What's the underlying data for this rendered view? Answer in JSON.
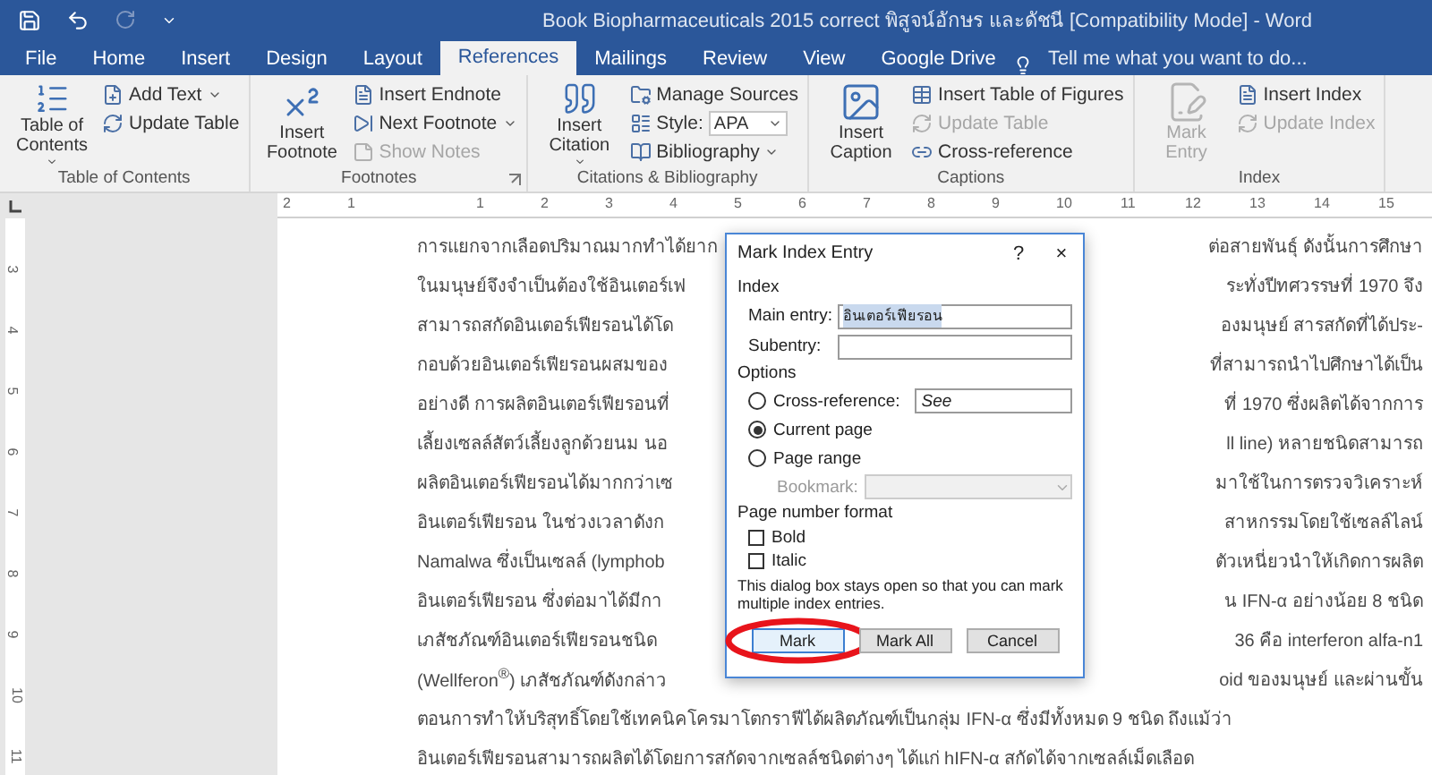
{
  "title_bar": {
    "title": "Book Biopharmaceuticals 2015 correct พิสูจน์อักษร และดัชนี [Compatibility Mode] - Word"
  },
  "tabs": [
    {
      "label": "File",
      "selected": false
    },
    {
      "label": "Home",
      "selected": false
    },
    {
      "label": "Insert",
      "selected": false
    },
    {
      "label": "Design",
      "selected": false
    },
    {
      "label": "Layout",
      "selected": false
    },
    {
      "label": "References",
      "selected": true
    },
    {
      "label": "Mailings",
      "selected": false
    },
    {
      "label": "Review",
      "selected": false
    },
    {
      "label": "View",
      "selected": false
    },
    {
      "label": "Google Drive",
      "selected": false
    }
  ],
  "tell_me": {
    "placeholder": "Tell me what you want to do..."
  },
  "ribbon_groups": [
    {
      "label": "Table of Contents",
      "launcher": false,
      "large": {
        "label": "Table of Contents",
        "dropdown": true,
        "disabled": false
      },
      "small": [
        {
          "kind": "button",
          "label": "Add Text",
          "dropdown": true,
          "disabled": false
        },
        {
          "kind": "button",
          "label": "Update Table",
          "dropdown": false,
          "disabled": false
        }
      ]
    },
    {
      "label": "Footnotes",
      "launcher": true,
      "large": {
        "label": "Insert Footnote",
        "dropdown": false,
        "disabled": false
      },
      "small": [
        {
          "kind": "button",
          "label": "Insert Endnote",
          "dropdown": false,
          "disabled": false
        },
        {
          "kind": "button",
          "label": "Next Footnote",
          "dropdown": true,
          "disabled": false
        },
        {
          "kind": "button",
          "label": "Show Notes",
          "dropdown": false,
          "disabled": true
        }
      ]
    },
    {
      "label": "Citations & Bibliography",
      "launcher": false,
      "large": {
        "label": "Insert Citation",
        "dropdown": true,
        "disabled": false
      },
      "small": [
        {
          "kind": "button",
          "label": "Manage Sources",
          "dropdown": false,
          "disabled": false
        },
        {
          "kind": "select",
          "label": "Style:",
          "value": "APA",
          "disabled": false
        },
        {
          "kind": "button",
          "label": "Bibliography",
          "dropdown": true,
          "disabled": false
        }
      ]
    },
    {
      "label": "Captions",
      "launcher": false,
      "large": {
        "label": "Insert Caption",
        "dropdown": false,
        "disabled": false
      },
      "small": [
        {
          "kind": "button",
          "label": "Insert Table of Figures",
          "dropdown": false,
          "disabled": false
        },
        {
          "kind": "button",
          "label": "Update Table",
          "dropdown": false,
          "disabled": true
        },
        {
          "kind": "button",
          "label": "Cross-reference",
          "dropdown": false,
          "disabled": false
        }
      ]
    },
    {
      "label": "Index",
      "launcher": false,
      "large": {
        "label": "Mark Entry",
        "dropdown": false,
        "disabled": true
      },
      "small": [
        {
          "kind": "button",
          "label": "Insert Index",
          "dropdown": false,
          "disabled": false
        },
        {
          "kind": "button",
          "label": "Update Index",
          "dropdown": false,
          "disabled": true
        }
      ]
    }
  ],
  "rulers": {
    "horizontal": [
      "2",
      "1",
      "1",
      "2",
      "3",
      "4",
      "5",
      "6",
      "7",
      "8",
      "9",
      "10",
      "11",
      "12",
      "13",
      "14",
      "15"
    ],
    "vertical": [
      "3",
      "4",
      "5",
      "6",
      "7",
      "8",
      "9",
      "10",
      "11"
    ]
  },
  "document": {
    "lines": [
      {
        "left": "การแยกจากเลือดปริมาณมากทำได้ยาก",
        "right": "ต่อสายพันธุ์ ดังนั้นการศึกษา"
      },
      {
        "left": "ในมนุษย์จึงจำเป็นต้องใช้อินเตอร์เฟ",
        "right": "ระทั่งปีทศวรรษที่ 1970 จึง"
      },
      {
        "left": "สามารถสกัดอินเตอร์เฟียรอนได้โด",
        "right": "องมนุษย์ สารสกัดที่ได้ประ-"
      },
      {
        "left": "กอบด้วยอินเตอร์เฟียรอนผสมของ",
        "right": "ที่สามารถนำไปศึกษาได้เป็น"
      },
      {
        "left": "อย่างดี การผลิตอินเตอร์เฟียรอนที่",
        "right": "ที่ 1970 ซึ่งผลิตได้จากการ"
      },
      {
        "left": "เลี้ยงเซลล์สัตว์เลี้ยงลูกด้วยนม นอ",
        "right": "ll line) หลายชนิดสามารถ"
      },
      {
        "left": "ผลิตอินเตอร์เฟียรอนได้มากกว่าเซ",
        "right": "มาใช้ในการตรวจวิเคราะห์"
      },
      {
        "left": "อินเตอร์เฟียรอน ในช่วงเวลาดังก",
        "right": "สาหกรรมโดยใช้เซลล์ไลน์"
      },
      {
        "left": "Namalwa ซึ่งเป็นเซลล์ (lymphob",
        "right": "ตัวเหนี่ยวนำให้เกิดการผลิต"
      },
      {
        "left": "อินเตอร์เฟียรอน ซึ่งต่อมาได้มีกา",
        "right": "น IFN-α อย่างน้อย 8 ชนิด"
      },
      {
        "left": "เภสัชภัณฑ์อินเตอร์เฟียรอนชนิด",
        "right": "36 คือ interferon alfa-n1"
      },
      {
        "left": "(Wellferon$^{®}$) เภสัชภัณฑ์ดังกล่าว",
        "right": "oid ของมนุษย์ และผ่านขั้น"
      },
      {
        "text": "ตอนการทำให้บริสุทธิ์โดยใช้เทคนิคโครมาโตกราฟีได้ผลิตภัณฑ์เป็นกลุ่ม IFN-α ซึ่งมีทั้งหมด 9 ชนิด ถึงแม้ว่า"
      },
      {
        "text": "อินเตอร์เฟียรอนสามารถผลิตได้โดยการสกัดจากเซลล์ชนิดต่างๆ ได้แก่ hIFN-α สกัดได้จากเซลล์เม็ดเลือด"
      }
    ]
  },
  "dialog": {
    "title": "Mark Index Entry",
    "help": "?",
    "close": "×",
    "index_section": {
      "label": "Index",
      "main_entry": {
        "label": "Main entry:",
        "value": "อินเตอร์เฟียรอน",
        "selected": true
      },
      "subentry": {
        "label": "Subentry:"
      }
    },
    "options": {
      "label": "Options",
      "choices": [
        {
          "label": "Cross-reference:",
          "selected": false,
          "value": "See"
        },
        {
          "label": "Current page",
          "selected": true
        },
        {
          "label": "Page range",
          "selected": false
        }
      ],
      "bookmark": {
        "label": "Bookmark:",
        "disabled": true
      }
    },
    "page_number_format": {
      "label": "Page number format",
      "checks": [
        {
          "label": "Bold",
          "checked": false
        },
        {
          "label": "Italic",
          "checked": false
        }
      ]
    },
    "note": "This dialog box stays open so that you can mark multiple index entries.",
    "buttons": [
      {
        "label": "Mark",
        "default": true,
        "circled": true
      },
      {
        "label": "Mark All",
        "default": false,
        "circled": false
      },
      {
        "label": "Cancel",
        "default": false,
        "circled": false
      }
    ]
  }
}
